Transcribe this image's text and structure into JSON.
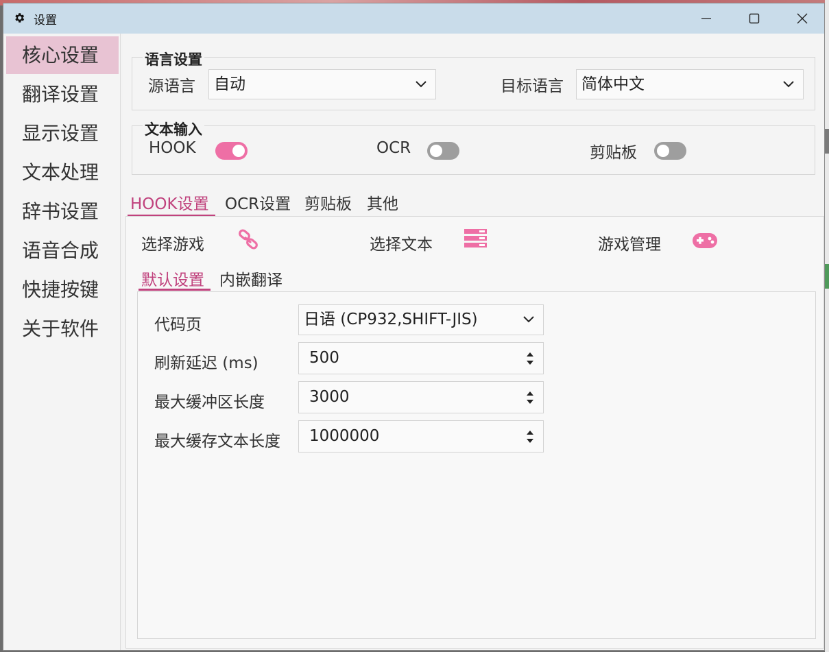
{
  "window": {
    "title": "设置",
    "icons": {
      "title": "gear-icon",
      "minimize": "minimize-icon",
      "maximize": "maximize-icon",
      "close": "close-icon"
    }
  },
  "colors": {
    "accent": "#c0427d",
    "toggle_on": "#ee6fa5",
    "toggle_off": "#9e9e9e",
    "sidebar_active": "#e8c3d3",
    "titlebar": "#c9dcea"
  },
  "sidebar": {
    "items": [
      {
        "label": "核心设置",
        "active": true
      },
      {
        "label": "翻译设置",
        "active": false
      },
      {
        "label": "显示设置",
        "active": false
      },
      {
        "label": "文本处理",
        "active": false
      },
      {
        "label": "辞书设置",
        "active": false
      },
      {
        "label": "语音合成",
        "active": false
      },
      {
        "label": "快捷按键",
        "active": false
      },
      {
        "label": "关于软件",
        "active": false
      }
    ]
  },
  "language": {
    "title": "语言设置",
    "source_label": "源语言",
    "source_value": "自动",
    "target_label": "目标语言",
    "target_value": "简体中文"
  },
  "text_input": {
    "title": "文本输入",
    "hook_label": "HOOK",
    "hook_on": true,
    "ocr_label": "OCR",
    "ocr_on": false,
    "clipboard_label": "剪贴板",
    "clipboard_on": false
  },
  "tabs": [
    {
      "label": "HOOK设置",
      "active": true
    },
    {
      "label": "OCR设置",
      "active": false
    },
    {
      "label": "剪贴板",
      "active": false
    },
    {
      "label": "其他",
      "active": false
    }
  ],
  "hook": {
    "select_game_label": "选择游戏",
    "select_game_icon": "link-icon",
    "select_text_label": "选择文本",
    "select_text_icon": "list-icon",
    "game_manage_label": "游戏管理",
    "game_manage_icon": "gamepad-icon",
    "subtabs": [
      {
        "label": "默认设置",
        "active": true
      },
      {
        "label": "内嵌翻译",
        "active": false
      }
    ],
    "fields": {
      "codepage_label": "代码页",
      "codepage_value": "日语 (CP932,SHIFT-JIS)",
      "refresh_label": "刷新延迟 (ms)",
      "refresh_value": "500",
      "buffer_label": "最大缓冲区长度",
      "buffer_value": "3000",
      "cache_label": "最大缓存文本长度",
      "cache_value": "1000000"
    }
  }
}
